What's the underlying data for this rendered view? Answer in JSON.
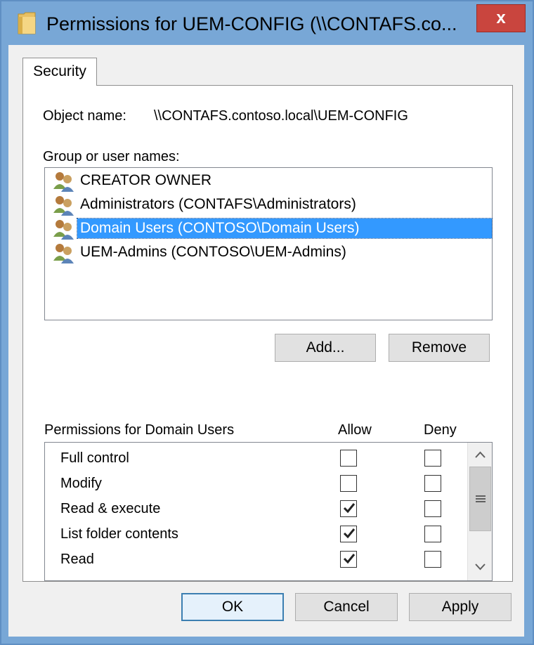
{
  "window": {
    "title": "Permissions for UEM-CONFIG (\\\\CONTAFS.co...",
    "close_label": "x"
  },
  "tabs": [
    {
      "label": "Security"
    }
  ],
  "object": {
    "label": "Object name:",
    "value": "\\\\CONTAFS.contoso.local\\UEM-CONFIG"
  },
  "group_list": {
    "label": "Group or user names:",
    "items": [
      {
        "name": "CREATOR OWNER",
        "selected": false
      },
      {
        "name": "Administrators (CONTAFS\\Administrators)",
        "selected": false
      },
      {
        "name": "Domain Users (CONTOSO\\Domain Users)",
        "selected": true
      },
      {
        "name": "UEM-Admins (CONTOSO\\UEM-Admins)",
        "selected": false
      }
    ]
  },
  "buttons": {
    "add": "Add...",
    "remove": "Remove",
    "ok": "OK",
    "cancel": "Cancel",
    "apply": "Apply"
  },
  "permissions": {
    "label": "Permissions for Domain Users",
    "allow_header": "Allow",
    "deny_header": "Deny",
    "rows": [
      {
        "name": "Full control",
        "allow": false,
        "deny": false
      },
      {
        "name": "Modify",
        "allow": false,
        "deny": false
      },
      {
        "name": "Read & execute",
        "allow": true,
        "deny": false
      },
      {
        "name": "List folder contents",
        "allow": true,
        "deny": false
      },
      {
        "name": "Read",
        "allow": true,
        "deny": false
      }
    ]
  },
  "colors": {
    "selection": "#3399ff",
    "close_button": "#c9453e",
    "frame": "#78a7d6"
  }
}
